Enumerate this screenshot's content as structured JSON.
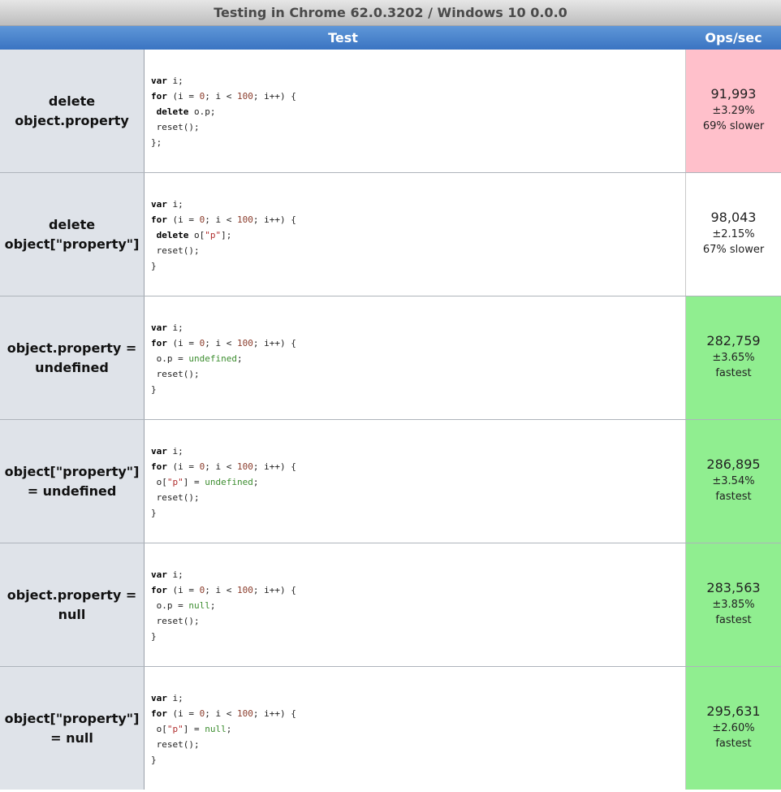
{
  "title": "Testing in Chrome 62.0.3202 / Windows 10 0.0.0",
  "header": {
    "test_label": "Test",
    "ops_label": "Ops/sec"
  },
  "colors": {
    "slow": "#ffc0cb",
    "fastest": "#90ee90",
    "neutral": "#ffffff",
    "header_blue": "#4a83cc"
  },
  "rows": [
    {
      "name_line1": "delete",
      "name_line2": "object.property",
      "code": {
        "l1_kw": "var",
        "l1_rest": " i;",
        "l2_kw": "for",
        "l2_a": " (i = ",
        "l2_n1": "0",
        "l2_b": "; i < ",
        "l2_n2": "100",
        "l2_c": "; i++) {",
        "l3_pre": " ",
        "l3_kw": "delete",
        "l3_a": " o.p",
        "l3_s": "",
        "l3_b": "",
        "l3_lit": "",
        "l3_end": ";",
        "l4": " reset();",
        "l5": "};"
      },
      "ops": "91,993",
      "err": "±3.29%",
      "rel": "69% slower",
      "status": "slow"
    },
    {
      "name_line1": "delete",
      "name_line2": "object[\"property\"]",
      "code": {
        "l1_kw": "var",
        "l1_rest": " i;",
        "l2_kw": "for",
        "l2_a": " (i = ",
        "l2_n1": "0",
        "l2_b": "; i < ",
        "l2_n2": "100",
        "l2_c": "; i++) {",
        "l3_pre": " ",
        "l3_kw": "delete",
        "l3_a": " o[",
        "l3_s": "\"p\"",
        "l3_b": "]",
        "l3_lit": "",
        "l3_end": ";",
        "l4": " reset();",
        "l5": "}"
      },
      "ops": "98,043",
      "err": "±2.15%",
      "rel": "67% slower",
      "status": "none"
    },
    {
      "name_line1": "object.property =",
      "name_line2": "undefined",
      "code": {
        "l1_kw": "var",
        "l1_rest": " i;",
        "l2_kw": "for",
        "l2_a": " (i = ",
        "l2_n1": "0",
        "l2_b": "; i < ",
        "l2_n2": "100",
        "l2_c": "; i++) {",
        "l3_pre": " ",
        "l3_kw": "",
        "l3_a": "o.p",
        "l3_s": "",
        "l3_b": " = ",
        "l3_lit": "undefined",
        "l3_end": ";",
        "l4": " reset();",
        "l5": "}"
      },
      "ops": "282,759",
      "err": "±3.65%",
      "rel": "fastest",
      "status": "fast"
    },
    {
      "name_line1": "object[\"property\"]",
      "name_line2": "= undefined",
      "code": {
        "l1_kw": "var",
        "l1_rest": " i;",
        "l2_kw": "for",
        "l2_a": " (i = ",
        "l2_n1": "0",
        "l2_b": "; i < ",
        "l2_n2": "100",
        "l2_c": "; i++) {",
        "l3_pre": " ",
        "l3_kw": "",
        "l3_a": "o[",
        "l3_s": "\"p\"",
        "l3_b": "] = ",
        "l3_lit": "undefined",
        "l3_end": ";",
        "l4": " reset();",
        "l5": "}"
      },
      "ops": "286,895",
      "err": "±3.54%",
      "rel": "fastest",
      "status": "fast"
    },
    {
      "name_line1": "object.property =",
      "name_line2": "null",
      "code": {
        "l1_kw": "var",
        "l1_rest": " i;",
        "l2_kw": "for",
        "l2_a": " (i = ",
        "l2_n1": "0",
        "l2_b": "; i < ",
        "l2_n2": "100",
        "l2_c": "; i++) {",
        "l3_pre": " ",
        "l3_kw": "",
        "l3_a": "o.p",
        "l3_s": "",
        "l3_b": " = ",
        "l3_lit": "null",
        "l3_end": ";",
        "l4": " reset();",
        "l5": "}"
      },
      "ops": "283,563",
      "err": "±3.85%",
      "rel": "fastest",
      "status": "fast"
    },
    {
      "name_line1": "object[\"property\"]",
      "name_line2": "= null",
      "code": {
        "l1_kw": "var",
        "l1_rest": " i;",
        "l2_kw": "for",
        "l2_a": " (i = ",
        "l2_n1": "0",
        "l2_b": "; i < ",
        "l2_n2": "100",
        "l2_c": "; i++) {",
        "l3_pre": " ",
        "l3_kw": "",
        "l3_a": "o[",
        "l3_s": "\"p\"",
        "l3_b": "] = ",
        "l3_lit": "null",
        "l3_end": ";",
        "l4": " reset();",
        "l5": "}"
      },
      "ops": "295,631",
      "err": "±2.60%",
      "rel": "fastest",
      "status": "fast"
    }
  ]
}
